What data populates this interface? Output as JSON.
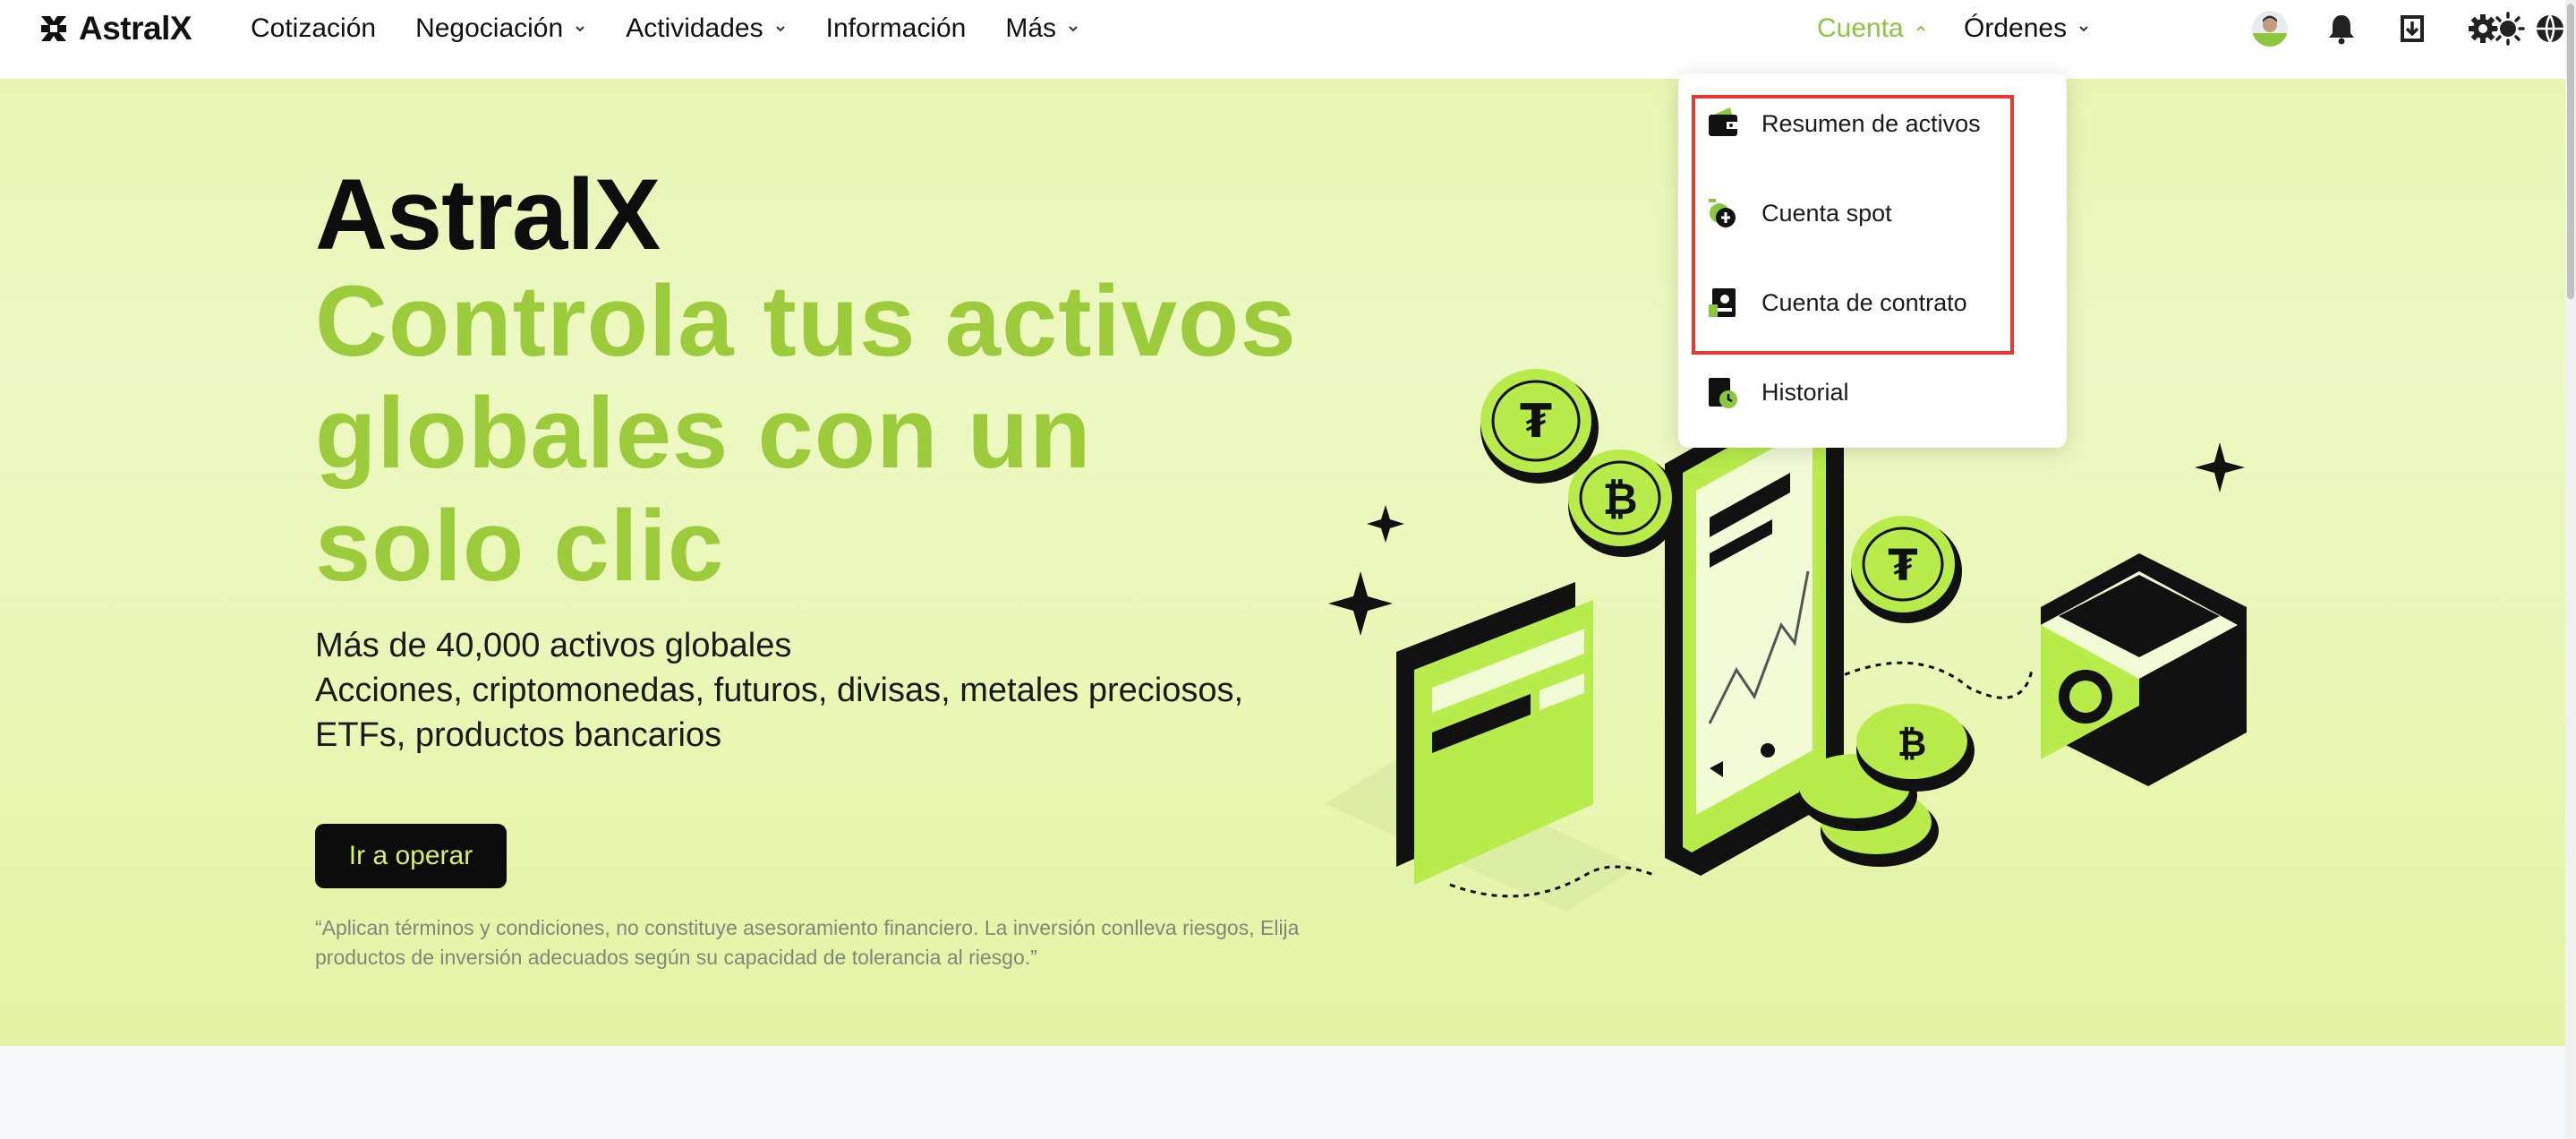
{
  "brand": {
    "name": "AstralX"
  },
  "nav": {
    "items": [
      {
        "label": "Cotización",
        "has_dropdown": false
      },
      {
        "label": "Negociación",
        "has_dropdown": true
      },
      {
        "label": "Actividades",
        "has_dropdown": true
      },
      {
        "label": "Información",
        "has_dropdown": false
      },
      {
        "label": "Más",
        "has_dropdown": true
      }
    ],
    "account_label": "Cuenta",
    "orders_label": "Órdenes",
    "icons": [
      "avatar",
      "bell-icon",
      "download-icon",
      "gear-icon",
      "globe-icon",
      "theme-icon"
    ]
  },
  "account_menu": {
    "items": [
      {
        "label": "Resumen de activos",
        "icon": "wallet-icon"
      },
      {
        "label": "Cuenta spot",
        "icon": "spot-account-icon"
      },
      {
        "label": "Cuenta de contrato",
        "icon": "contract-account-icon"
      },
      {
        "label": "Historial",
        "icon": "history-icon"
      }
    ]
  },
  "hero": {
    "brand_title": "AstralX",
    "headline": "Controla tus activos globales con un solo clic",
    "sub_line_1": "Más de 40,000 activos globales",
    "sub_line_2": "Acciones, criptomonedas, futuros, divisas, metales preciosos,",
    "sub_line_3": "ETFs, productos bancarios",
    "cta_label": "Ir a operar",
    "disclaimer": "“Aplican términos y condiciones, no constituye asesoramiento financiero. La inversión conlleva riesgos, Elija productos de inversión adecuados según su capacidad de tolerancia al riesgo.”"
  },
  "colors": {
    "accent_green": "#9ccc3c",
    "account_active": "#8cc63f",
    "cta_bg": "#0b0b0b",
    "cta_text": "#d7f25a",
    "highlight_red": "#e53935"
  }
}
